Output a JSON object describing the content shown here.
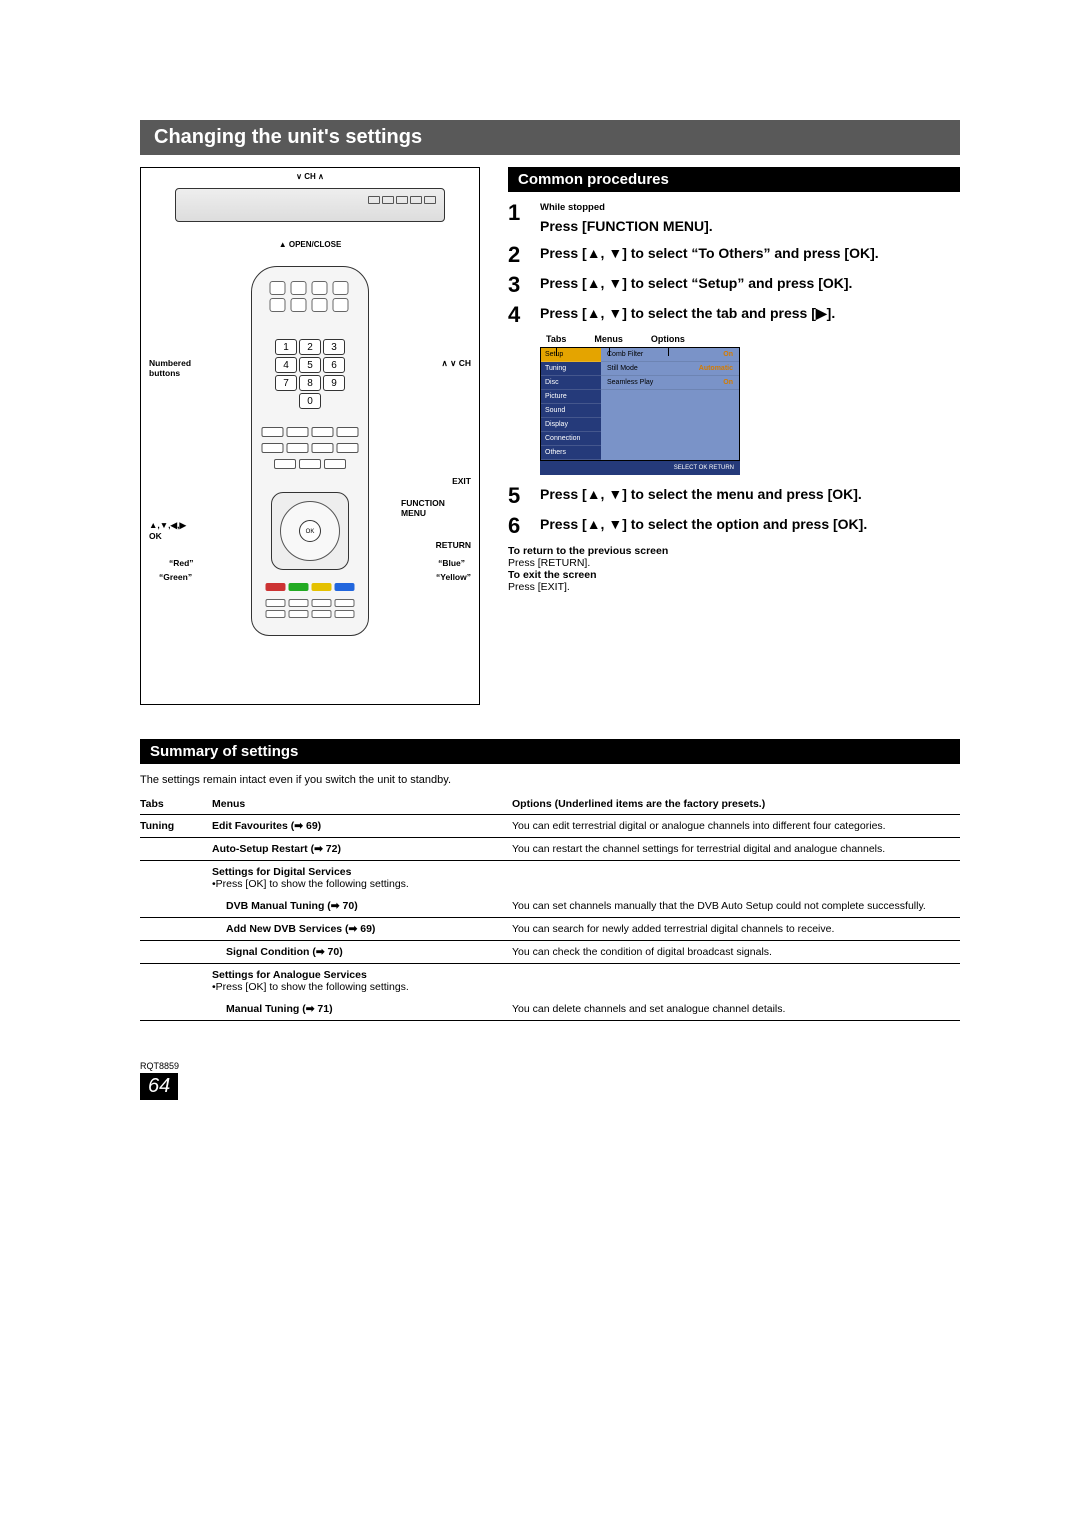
{
  "title": "Changing the unit's settings",
  "device_labels": {
    "ch_top": "∨ CH ∧",
    "open_close": "▲ OPEN/CLOSE"
  },
  "remote": {
    "keypad": [
      "1",
      "2",
      "3",
      "4",
      "5",
      "6",
      "7",
      "8",
      "9",
      "0"
    ],
    "ok": "OK"
  },
  "remote_callouts": {
    "numbered": "Numbered buttons",
    "ch_side": "∧ ∨ CH",
    "arrows_ok": "▲,▼,◀,▶\nOK",
    "red": "“Red”",
    "green": "“Green”",
    "exit": "EXIT",
    "function_menu": "FUNCTION MENU",
    "return": "RETURN",
    "blue": "“Blue”",
    "yellow": "“Yellow”"
  },
  "procedures": {
    "heading": "Common procedures",
    "steps": [
      {
        "pre": "While stopped",
        "text": "Press [FUNCTION MENU]."
      },
      {
        "text": "Press [▲, ▼] to select “To Others” and press [OK]."
      },
      {
        "text": "Press [▲, ▼] to select “Setup” and press [OK]."
      },
      {
        "text": "Press [▲, ▼] to select the tab and press [▶]."
      },
      {
        "text": "Press [▲, ▼] to select the menu and press [OK]."
      },
      {
        "text": "Press [▲, ▼] to select the option and press [OK]."
      }
    ],
    "osd_header": {
      "tabs": "Tabs",
      "menus": "Menus",
      "options": "Options"
    },
    "osd": {
      "tabs": [
        "Setup",
        "Tuning",
        "Disc",
        "Picture",
        "Sound",
        "Display",
        "Connection",
        "Others"
      ],
      "menus": [
        {
          "name": "Comb Filter",
          "opt": "On"
        },
        {
          "name": "Still Mode",
          "opt": "Automatic"
        },
        {
          "name": "Seamless Play",
          "opt": "On"
        }
      ],
      "footer": "SELECT    OK    RETURN"
    },
    "return_head": "To return to the previous screen",
    "return_body": "Press [RETURN].",
    "exit_head": "To exit the screen",
    "exit_body": "Press [EXIT]."
  },
  "summary": {
    "heading": "Summary of settings",
    "note": "The settings remain intact even if you switch the unit to standby.",
    "headers": {
      "tabs": "Tabs",
      "menus": "Menus",
      "options": "Options (Underlined items are the factory presets.)"
    },
    "tab": "Tuning",
    "rows": [
      {
        "menu": "Edit Favourites (➡ 69)",
        "opt": "You can edit terrestrial digital or analogue channels into different four categories."
      },
      {
        "menu": "Auto-Setup Restart (➡ 72)",
        "opt": "You can restart the channel settings for terrestrial digital and analogue channels."
      },
      {
        "menu": "Settings for Digital Services",
        "sub": "•Press [OK] to show the following settings.",
        "opt": "",
        "noborder": true
      },
      {
        "menu": "DVB Manual Tuning (➡ 70)",
        "opt": "You can set channels manually that the DVB Auto Setup could not complete successfully.",
        "indent": true
      },
      {
        "menu": "Add New DVB Services (➡ 69)",
        "opt": "You can search for newly added terrestrial digital channels to receive.",
        "indent": true
      },
      {
        "menu": "Signal Condition (➡ 70)",
        "opt": "You can check the condition of digital broadcast signals.",
        "indent": true
      },
      {
        "menu": "Settings for Analogue Services",
        "sub": "•Press [OK] to show the following settings.",
        "opt": "",
        "noborder": true
      },
      {
        "menu": "Manual Tuning (➡ 71)",
        "opt": "You can delete channels and set analogue channel details.",
        "indent": true,
        "heavy": true
      }
    ]
  },
  "footer": {
    "code": "RQT8859",
    "page": "64"
  }
}
